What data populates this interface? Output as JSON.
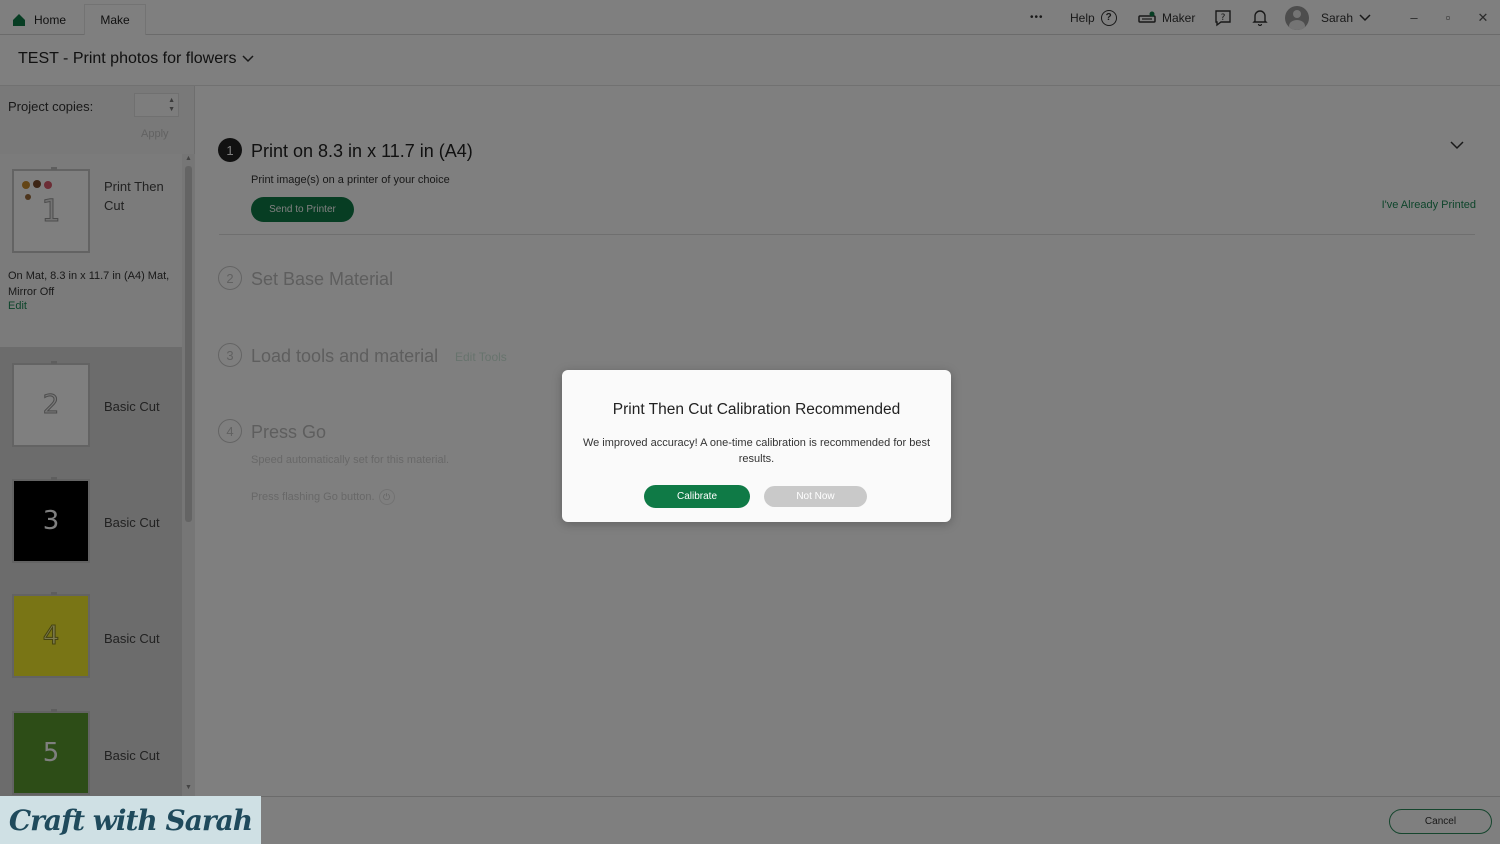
{
  "tabs": {
    "home": "Home",
    "make": "Make"
  },
  "topbar": {
    "more": "•••",
    "help": "Help",
    "help_icon": "?",
    "machine": "Maker",
    "user": "Sarah",
    "minimize": "–",
    "restore": "▫",
    "close": "✕"
  },
  "project": {
    "title": "TEST - Print photos for flowers"
  },
  "sidebar": {
    "copies_label": "Project copies:",
    "apply": "Apply",
    "mats": [
      {
        "number": "1",
        "name": "Print Then Cut",
        "color": "#ffffff",
        "details": "On Mat, 8.3 in x 11.7 in (A4) Mat, Mirror Off",
        "edit": "Edit"
      },
      {
        "number": "2",
        "name": "Basic Cut",
        "color": "#ffffff"
      },
      {
        "number": "3",
        "name": "Basic Cut",
        "color": "#000000"
      },
      {
        "number": "4",
        "name": "Basic Cut",
        "color": "#f2ea2a"
      },
      {
        "number": "5",
        "name": "Basic Cut",
        "color": "#5a9a2e"
      }
    ]
  },
  "steps": [
    {
      "number": "1",
      "title": "Print on 8.3 in x 11.7 in (A4)",
      "subtitle": "Print image(s) on a printer of your choice",
      "button": "Send to Printer",
      "alt_link": "I've Already Printed"
    },
    {
      "number": "2",
      "title": "Set Base Material"
    },
    {
      "number": "3",
      "title": "Load tools and material",
      "link": "Edit Tools"
    },
    {
      "number": "4",
      "title": "Press Go",
      "subtitle": "Speed automatically set for this material.",
      "hint": "Press flashing Go button."
    }
  ],
  "bottom": {
    "cancel": "Cancel",
    "watermark": "Craft with Sarah"
  },
  "modal": {
    "title": "Print Then Cut Calibration Recommended",
    "body": "We improved accuracy! A one-time calibration is recommended for best results.",
    "primary": "Calibrate",
    "secondary": "Not Now"
  },
  "colors": {
    "accent": "#0f7a46",
    "link": "#1c8a57"
  }
}
